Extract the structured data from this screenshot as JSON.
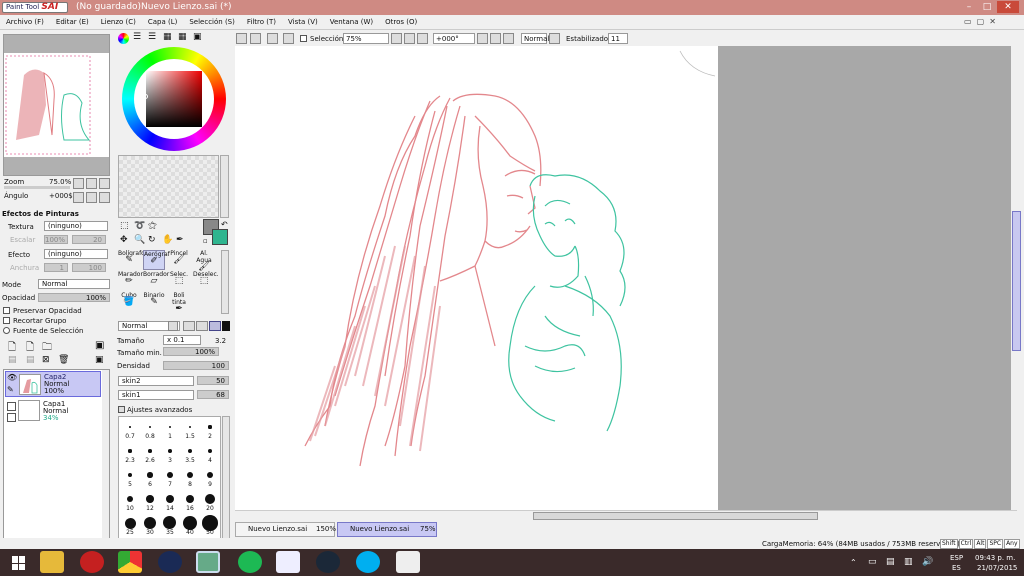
{
  "app": {
    "logo_small": "Paint Tool",
    "logo_big": "SAI",
    "title": "(No guardado)Nuevo Lienzo.sai (*)"
  },
  "menu": [
    "Archivo (F)",
    "Editar (E)",
    "Lienzo (C)",
    "Capa (L)",
    "Selección (S)",
    "Filtro (T)",
    "Vista (V)",
    "Ventana (W)",
    "Otros (O)"
  ],
  "toolbar": {
    "selection_label": "Selección",
    "zoom": "75%",
    "angle": "+000°",
    "blend": "Normal",
    "stabilizer_label": "Estabilizador",
    "stabilizer": "11"
  },
  "navigator": {
    "zoom_label": "Zoom",
    "zoom": "75.0%",
    "angle_label": "Ángulo",
    "angle": "+000$"
  },
  "effects": {
    "header": "Efectos de Pinturas",
    "texture_label": "Textura",
    "texture": "(ninguno)",
    "scale_label": "Escalar",
    "scale": "100%",
    "scale_num": "20",
    "effect_label": "Efecto",
    "effect": "(ninguno)",
    "width_label": "Anchura",
    "width": "1",
    "width_num": "100"
  },
  "layer_props": {
    "mode_label": "Mode",
    "mode": "Normal",
    "opacity_label": "Opacidad",
    "opacity": "100%",
    "opacity_pct": 100,
    "preserve": "Preservar Opacidad",
    "clip": "Recortar Grupo",
    "source": "Fuente de Selección"
  },
  "layers": [
    {
      "name": "Capa2",
      "mode": "Normal",
      "opacity": "100%"
    },
    {
      "name": "Capa1",
      "mode": "Normal",
      "opacity": "34%"
    }
  ],
  "tools": [
    {
      "label": "Bolígrafo",
      "icon": "pen-icon"
    },
    {
      "label": "Aerógraf",
      "icon": "airbrush-icon"
    },
    {
      "label": "Pincel",
      "icon": "brush-icon"
    },
    {
      "label": "Al. Agua",
      "icon": "watercolor-icon"
    },
    {
      "label": "Marador",
      "icon": "marker-icon"
    },
    {
      "label": "Borrador",
      "icon": "eraser-icon"
    },
    {
      "label": "Selec.",
      "icon": "select-icon"
    },
    {
      "label": "Deselec.",
      "icon": "deselect-icon"
    },
    {
      "label": "Cubo",
      "icon": "bucket-icon"
    },
    {
      "label": "Binario",
      "icon": "binary-icon"
    },
    {
      "label": "Boli tinta",
      "icon": "inkpen-icon"
    }
  ],
  "brush": {
    "blend": "Normal",
    "size_label": "Tamaño",
    "size_mult": "x 0.1",
    "size": "3.2",
    "minsize_label": "Tamaño min.",
    "minsize": "100%",
    "minsize_pct": 100,
    "density_label": "Densidad",
    "density": "100",
    "density_pct": 100,
    "shape": "skin2",
    "shape_val": "50",
    "texture": "skin1",
    "texture_val": "68",
    "advanced": "Ajustes avanzados"
  },
  "sizes": [
    "0.7",
    "0.8",
    "1",
    "1.5",
    "2",
    "2.3",
    "2.6",
    "3",
    "3.5",
    "4",
    "5",
    "6",
    "7",
    "8",
    "9",
    "10",
    "12",
    "14",
    "16",
    "20",
    "25",
    "30",
    "35",
    "40",
    "50"
  ],
  "tabs": [
    {
      "name": "Nuevo Lienzo.sai",
      "zoom": "150%"
    },
    {
      "name": "Nuevo Lienzo.sai",
      "zoom": "75%"
    }
  ],
  "status": {
    "memory": "CargaMemoria: 64% (84MB usados / 753MB reservados)",
    "keys": [
      "Shift",
      "Ctrl",
      "Alt",
      "SPC",
      "Any"
    ]
  },
  "taskbar": {
    "lang1": "ESP",
    "lang2": "ES",
    "time": "09:43 p. m.",
    "date": "21/07/2015"
  },
  "colors": {
    "titlebar": "#cf8a83",
    "primary": "#888888",
    "secondary": "#2fb58f",
    "red_sketch": "#e07b80",
    "teal_sketch": "#3ec3a0"
  }
}
